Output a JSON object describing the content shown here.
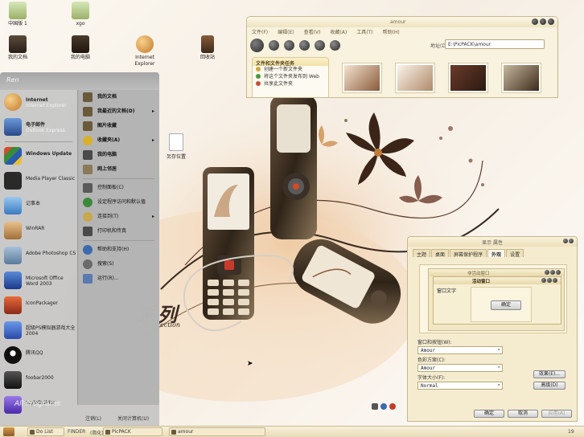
{
  "desktop": {
    "icons": [
      {
        "label": "中国版 1",
        "name": "desktop-icon-notepad-1"
      },
      {
        "label": "xgo",
        "name": "desktop-icon-xgo"
      },
      {
        "label": "我的文档",
        "name": "desktop-icon-my-documents"
      },
      {
        "label": "我的电脑",
        "name": "desktop-icon-my-computer"
      },
      {
        "label": "Internet Explorer",
        "name": "desktop-icon-internet-explorer"
      },
      {
        "label": "回收站",
        "name": "desktop-icon-recycle-bin"
      }
    ],
    "file_icon_label": "另存位置",
    "watermark": {
      "big": "系列",
      "small": "llection"
    }
  },
  "explorer": {
    "title": "amour",
    "menu": [
      "文件(F)",
      "编辑(E)",
      "查看(V)",
      "收藏(A)",
      "工具(T)",
      "帮助(H)"
    ],
    "address_label": "地址(D)",
    "address_value": "E:\\PicPACK\\amour",
    "task_pane": {
      "header": "文件和文件夹任务",
      "items": [
        "创建一个新文件夹",
        "将这个文件夹发布到 Web",
        "共享此文件夹"
      ]
    },
    "thumbnails": 4
  },
  "start_menu": {
    "user": "Ren",
    "pinned": [
      {
        "title": "Internet",
        "sub": "Internet Explorer",
        "name": "start-item-internet",
        "color": "#d88a2a"
      },
      {
        "title": "电子邮件",
        "sub": "Outlook Express",
        "name": "start-item-email",
        "color": "#3a6ab0"
      }
    ],
    "recent": [
      {
        "title": "Windows Update",
        "name": "start-item-windows-update",
        "color": "#3a8a3a"
      },
      {
        "title": "Media Player Classic",
        "name": "start-item-media-player-classic",
        "color": "#2a2a2a"
      },
      {
        "title": "记事本",
        "name": "start-item-notepad",
        "color": "#4a8ac8"
      },
      {
        "title": "WinRAR",
        "name": "start-item-winrar",
        "color": "#b07a3a"
      },
      {
        "title": "Adobe Photoshop CS",
        "name": "start-item-photoshop",
        "color": "#6a8aa8"
      },
      {
        "title": "Microsoft Office Word 2003",
        "name": "start-item-word",
        "color": "#2a5ab0"
      },
      {
        "title": "IconPackager",
        "name": "start-item-iconpackager",
        "color": "#c84a2a"
      },
      {
        "title": "超级PS模拟器游戏大全2004",
        "name": "start-item-ps-emulator",
        "color": "#3a6ac8"
      },
      {
        "title": "腾讯QQ",
        "name": "start-item-qq",
        "color": "#222222"
      },
      {
        "title": "foobar2000",
        "name": "start-item-foobar",
        "color": "#333333"
      },
      {
        "title": "StyleBuilder",
        "name": "start-item-stylebuilder",
        "color": "#6a4ab0"
      }
    ],
    "all_programs": "All Programs",
    "right": [
      {
        "label": "我的文档",
        "bold": true,
        "arrow": false,
        "name": "start-right-my-documents",
        "color": "#6a5a3a"
      },
      {
        "label": "我最近的文档(D)",
        "bold": true,
        "arrow": true,
        "name": "start-right-recent-documents",
        "color": "#6a5a3a"
      },
      {
        "label": "图片收藏",
        "bold": true,
        "arrow": false,
        "name": "start-right-my-pictures",
        "color": "#6a5a3a"
      },
      {
        "label": "收藏夹(A)",
        "bold": true,
        "arrow": true,
        "name": "start-right-favorites",
        "color": "#d8b02a"
      },
      {
        "label": "我的电脑",
        "bold": true,
        "arrow": false,
        "name": "start-right-my-computer",
        "color": "#4a4a4a"
      },
      {
        "label": "网上邻居",
        "bold": true,
        "arrow": false,
        "name": "start-right-network",
        "color": "#8a7a5a"
      },
      {
        "label": "控制面板(C)",
        "bold": false,
        "arrow": false,
        "name": "start-right-control-panel",
        "color": "#5a5a5a"
      },
      {
        "label": "设定程序访问和默认值",
        "bold": false,
        "arrow": false,
        "name": "start-right-program-defaults",
        "color": "#3a8a3a"
      },
      {
        "label": "连接到(T)",
        "bold": false,
        "arrow": true,
        "name": "start-right-connect-to",
        "color": "#c8a84a"
      },
      {
        "label": "打印机和传真",
        "bold": false,
        "arrow": false,
        "name": "start-right-printers",
        "color": "#4a4a4a"
      },
      {
        "label": "帮助和支持(H)",
        "bold": false,
        "arrow": false,
        "name": "start-right-help",
        "color": "#3a6ab0"
      },
      {
        "label": "搜索(S)",
        "bold": false,
        "arrow": false,
        "name": "start-right-search",
        "color": "#6a6a6a"
      },
      {
        "label": "运行(R)...",
        "bold": false,
        "arrow": false,
        "name": "start-right-run",
        "color": "#5a7ab0"
      }
    ],
    "footer": {
      "logoff": "注销(L)",
      "shutdown": "关闭计算机(U)"
    }
  },
  "display_dialog": {
    "title": "显示 属性",
    "tabs": [
      "主题",
      "桌面",
      "屏幕保护程序",
      "外观",
      "设置"
    ],
    "active_tab": "外观",
    "preview": {
      "inactive": "非活动窗口",
      "active": "活动窗口",
      "window_text": "窗口文字",
      "ok": "确定"
    },
    "window_style_label": "窗口和按钮(W):",
    "window_style_value": "Amour",
    "color_scheme_label": "色彩方案(C):",
    "color_scheme_value": "Amour",
    "font_size_label": "字体大小(F):",
    "font_size_value": "Normal",
    "effects_button": "效果(E)...",
    "advanced_button": "高级(D)",
    "ok_button": "确定",
    "cancel_button": "取消",
    "apply_button": "应用(A)"
  },
  "taskbar": {
    "items": [
      "Do List",
      "FINDER",
      "(简化)",
      "PicPACK",
      "amour"
    ],
    "clock": "19"
  }
}
